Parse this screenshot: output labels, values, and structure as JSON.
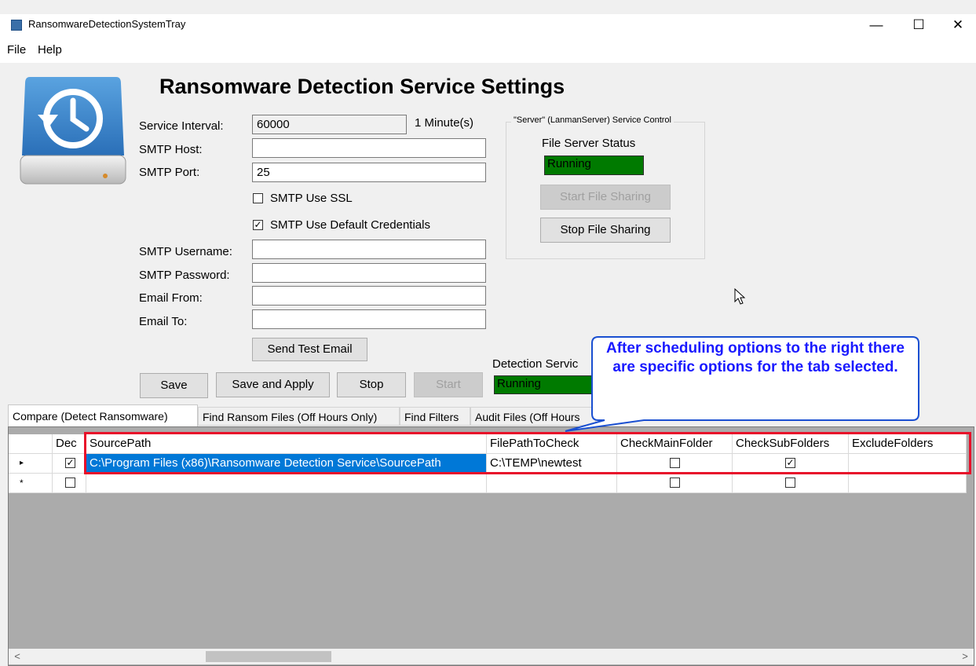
{
  "window": {
    "title": "RansomwareDetectionSystemTray",
    "minimize": "—",
    "maximize": "☐",
    "close": "✕"
  },
  "menu": [
    "File",
    "Help"
  ],
  "heading": "Ransomware Detection Service Settings",
  "form": {
    "interval_label": "Service Interval:",
    "interval_value": "60000",
    "interval_minutes": "1 Minute(s)",
    "smtp_host_label": "SMTP Host:",
    "smtp_host_value": "",
    "smtp_port_label": "SMTP Port:",
    "smtp_port_value": "25",
    "ssl_label": "SMTP Use SSL",
    "ssl_checked": false,
    "default_creds_label": "SMTP Use Default Credentials",
    "default_creds_checked": true,
    "username_label": "SMTP Username:",
    "username_value": "",
    "password_label": "SMTP Password:",
    "password_value": "",
    "email_from_label": "Email From:",
    "email_from_value": "",
    "email_to_label": "Email To:",
    "email_to_value": "",
    "send_test_email": "Send Test Email"
  },
  "server_group": {
    "title": "\"Server\" (LanmanServer) Service Control",
    "status_label": "File Server Status",
    "status_value": "Running",
    "start_button": "Start File Sharing",
    "stop_button": "Stop File Sharing"
  },
  "buttons": {
    "save": "Save",
    "save_apply": "Save and Apply",
    "stop": "Stop",
    "start": "Start"
  },
  "detection": {
    "label": "Detection Servic",
    "status_value": "Running"
  },
  "callout": "After scheduling options to the right there are specific options for the tab selected.",
  "tabs": [
    "Compare (Detect Ransomware)",
    "Find Ransom Files (Off Hours Only)",
    "Find Filters",
    "Audit Files (Off Hours"
  ],
  "grid": {
    "columns": [
      "Dec",
      "SourcePath",
      "FilePathToCheck",
      "CheckMainFolder",
      "CheckSubFolders",
      "ExcludeFolders"
    ],
    "rows": [
      {
        "marker": "▸",
        "dec": true,
        "source": "C:\\Program Files (x86)\\Ransomware Detection Service\\SourcePath",
        "file": "C:\\TEMP\\newtest",
        "main": false,
        "sub": true,
        "exclude": ""
      },
      {
        "marker": "*",
        "dec": false,
        "source": "",
        "file": "",
        "main": false,
        "sub": false,
        "exclude": ""
      }
    ]
  },
  "colors": {
    "status_green": "#007a00",
    "selection_blue": "#0078d7",
    "callout_text": "#1a1aff",
    "callout_border": "#1a4fd1",
    "highlight_red": "#e8102a",
    "grid_empty": "#ababab"
  },
  "icons": [
    "app-icon",
    "backup-drive-icon",
    "cursor-icon",
    "scroll-left-icon",
    "scroll-right-icon"
  ]
}
